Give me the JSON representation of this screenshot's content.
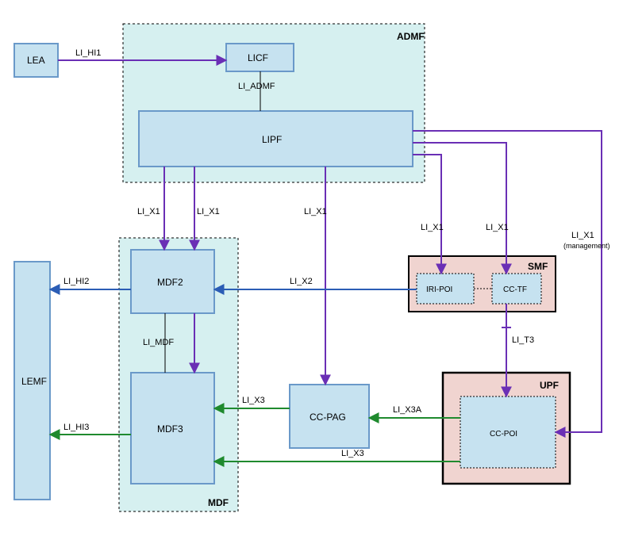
{
  "blocks": {
    "lea": "LEA",
    "admf": "ADMF",
    "licf": "LICF",
    "lipf": "LIPF",
    "lemf": "LEMF",
    "mdf": "MDF",
    "mdf2": "MDF2",
    "mdf3": "MDF3",
    "smf": "SMF",
    "iri_poi": "IRI-POI",
    "cc_tf": "CC-TF",
    "upf": "UPF",
    "cc_poi": "CC-POI",
    "cc_pag": "CC-PAG"
  },
  "edges": {
    "li_hi1": "LI_HI1",
    "li_admf": "LI_ADMF",
    "li_x1_a": "LI_X1",
    "li_x1_b": "LI_X1",
    "li_x1_c": "LI_X1",
    "li_x1_d": "LI_X1",
    "li_x1_e": "LI_X1",
    "li_x1_mgmt": "LI_X1",
    "li_x1_mgmt_sub": "(management)",
    "li_hi2": "LI_HI2",
    "li_hi3": "LI_HI3",
    "li_mdf": "LI_MDF",
    "li_x2": "LI_X2",
    "li_x3_a": "LI_X3",
    "li_x3_b": "LI_X3",
    "li_x3a": "LI_X3A",
    "li_t3": "LI_T3"
  },
  "colors": {
    "canvas": "#ffffff",
    "block_fill": "#c6e2f0",
    "block_stroke": "#6a99c9",
    "admf_fill": "#d6f0f0",
    "admf_stroke": "#000000",
    "mdf_fill": "#d6f0f0",
    "mdf_stroke": "#000000",
    "smf_fill": "#f0d4d0",
    "smf_stroke": "#000000",
    "upf_fill": "#f0d4d0",
    "upf_stroke": "#000000",
    "purple": "#6a2fb5",
    "blue": "#2b5db5",
    "green": "#1f8a2e"
  }
}
